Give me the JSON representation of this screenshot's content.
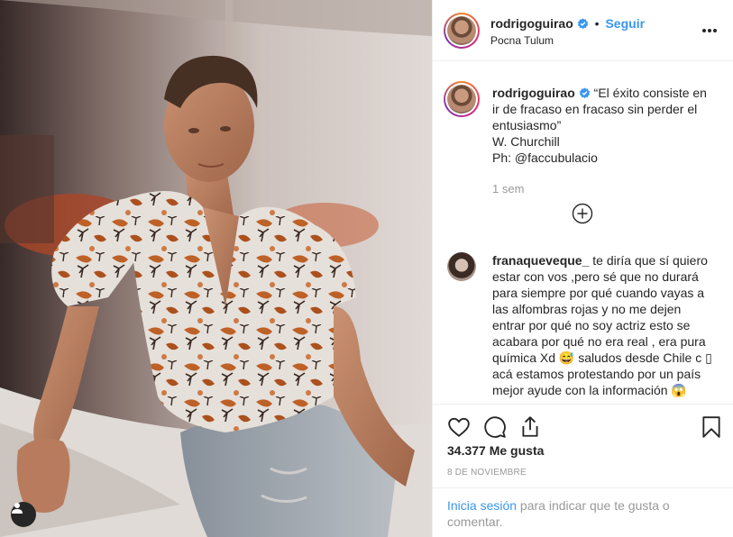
{
  "post": {
    "username": "rodrigoguirao",
    "verified_icon": "verified-badge-icon",
    "separator": "•",
    "follow_label": "Seguir",
    "location": "Pocna Tulum",
    "more_icon": "more-options-icon"
  },
  "caption": {
    "username": "rodrigoguirao",
    "line1": "“El éxito consiste en ir de fracaso en fracaso sin perder el entusiasmo”",
    "line2": "W. Churchill",
    "line3": "Ph: @faccubulacio",
    "time_ago": "1 sem"
  },
  "comment": {
    "username": "franaqueveque_",
    "text": "te diría que sí quiero estar con vos ,pero sé que no durará para siempre por qué cuando vayas a las alfombras rojas y no me dejen entrar por qué no soy actriz esto se acabara por qué no era real , era pura química Xd 😅 saludos desde Chile c ▯ acá estamos protestando por un país mejor ayude con la información 😱"
  },
  "actions": {
    "like_icon": "heart-icon",
    "comment_icon": "comment-bubble-icon",
    "share_icon": "share-icon",
    "save_icon": "bookmark-icon"
  },
  "likes": "34.377 Me gusta",
  "date": "8 DE NOVIEMBRE",
  "login": {
    "link": "Inicia sesión",
    "rest": " para indicar que te gusta o comentar."
  },
  "colors": {
    "link_blue": "#3897f0",
    "verified_blue": "#3897f0",
    "muted_gray": "#999999",
    "border": "#efefef"
  }
}
